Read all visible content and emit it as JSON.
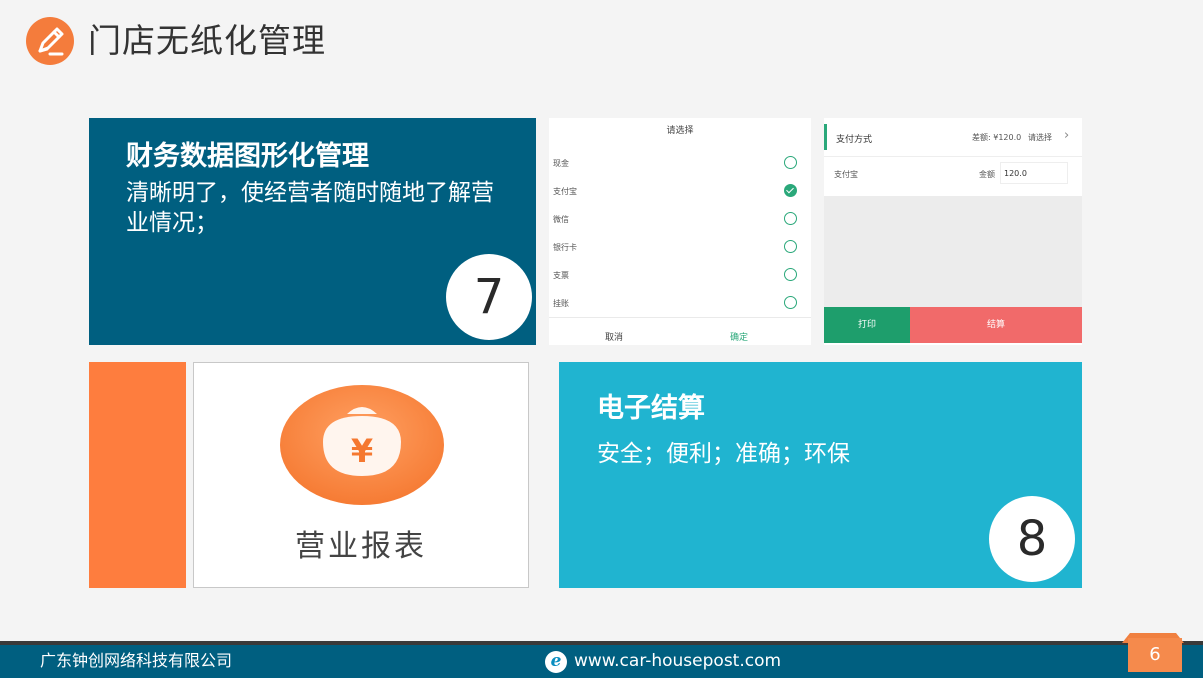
{
  "header": {
    "title": "门店无纸化管理",
    "logo_icon": "pencil-icon"
  },
  "finance_panel": {
    "title": "财务数据图形化管理",
    "description": "清晰明了，使经营者随时随地了解营业情况；",
    "number": "7",
    "color": "#005f80"
  },
  "payment_select": {
    "title": "请选择",
    "options": [
      {
        "label": "现金",
        "checked": false
      },
      {
        "label": "支付宝",
        "checked": true
      },
      {
        "label": "微信",
        "checked": false
      },
      {
        "label": "银行卡",
        "checked": false
      },
      {
        "label": "支票",
        "checked": false
      },
      {
        "label": "挂账",
        "checked": false
      }
    ],
    "cancel_label": "取消",
    "confirm_label": "确定"
  },
  "payment_method": {
    "title": "支付方式",
    "difference": "差额: ¥120.0",
    "choose_label": "请选择",
    "method": "支付宝",
    "amount_label": "金额",
    "amount_value": "120.0",
    "print_label": "打印",
    "settle_label": "结算"
  },
  "report_card": {
    "icon": "money-bag-icon",
    "icon_symbol": "¥",
    "label": "营业报表"
  },
  "settle_panel": {
    "title": "电子结算",
    "description": "安全；便利；准确；环保",
    "number": "8",
    "color": "#20b4d0"
  },
  "footer": {
    "company": "广东钟创网络科技有限公司",
    "url": "www.car-housepost.com",
    "browser_icon": "ie-icon",
    "browser_glyph": "e",
    "page_number": "6"
  }
}
